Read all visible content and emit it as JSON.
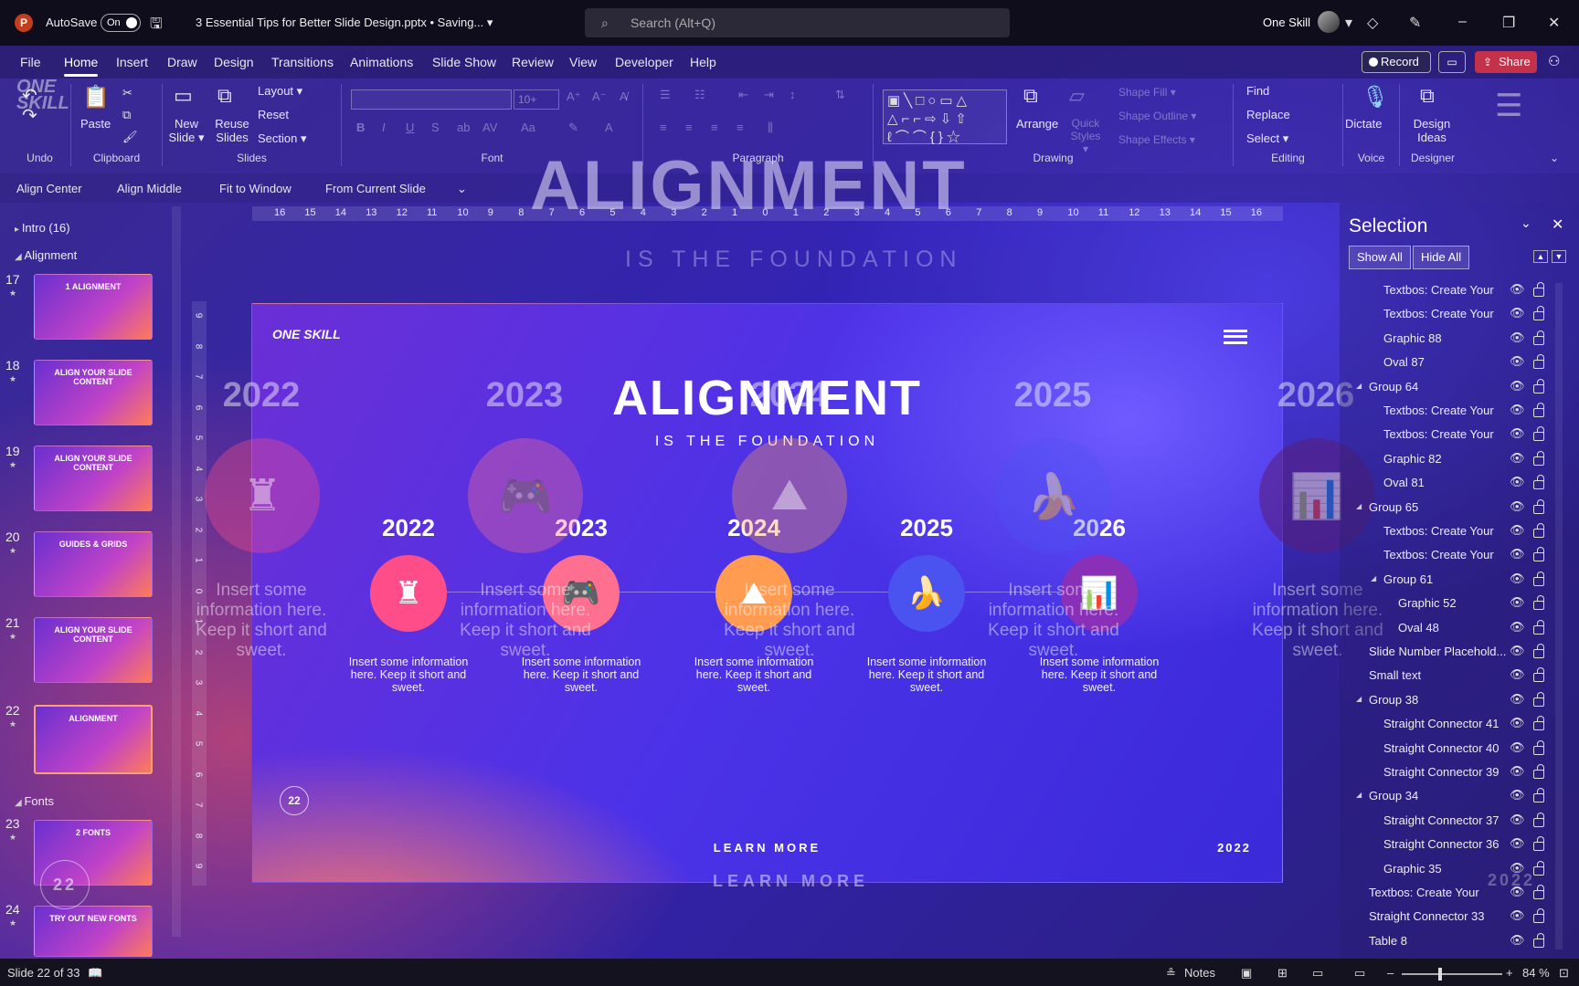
{
  "titlebar": {
    "autosave_label": "AutoSave",
    "autosave_state": "On",
    "doc_title": "3 Essential Tips for Better Slide Design.pptx • Saving... ▾",
    "search_placeholder": "Search (Alt+Q)",
    "user_name": "One Skill"
  },
  "menu": {
    "items": [
      "File",
      "Home",
      "Insert",
      "Draw",
      "Design",
      "Transitions",
      "Animations",
      "Slide Show",
      "Review",
      "View",
      "Developer",
      "Help"
    ],
    "active": "Home",
    "record": "Record",
    "share": "Share"
  },
  "ribbon": {
    "groups": {
      "undo": "Undo",
      "clipboard": "Clipboard",
      "slides": "Slides",
      "font": "Font",
      "paragraph": "Paragraph",
      "drawing": "Drawing",
      "editing": "Editing",
      "voice": "Voice",
      "designer": "Designer"
    },
    "paste": "Paste",
    "new_slide": "New Slide ▾",
    "reuse_slides": "Reuse Slides",
    "layout": "Layout ▾",
    "reset": "Reset",
    "section": "Section ▾",
    "font_size": "10+",
    "arrange": "Arrange",
    "quick_styles": "Quick Styles ▾",
    "shape_fill": "Shape Fill ▾",
    "shape_outline": "Shape Outline ▾",
    "shape_effects": "Shape Effects ▾",
    "find": "Find",
    "replace": "Replace",
    "select": "Select ▾",
    "dictate": "Dictate",
    "design_ideas": "Design Ideas"
  },
  "qat": {
    "align_center": "Align Center",
    "align_middle": "Align Middle",
    "fit_window": "Fit to Window",
    "from_current": "From Current Slide"
  },
  "overlay": {
    "title": "ALIGNMENT",
    "subtitle": "IS THE FOUNDATION",
    "years": [
      "2022",
      "2023",
      "2024",
      "2025",
      "2026"
    ],
    "desc": "Insert some information here. Keep it short and sweet.",
    "learn_more": "LEARN MORE",
    "footer_year": "2022"
  },
  "thumbnails": {
    "sections": {
      "intro": "Intro (16)",
      "alignment": "Alignment",
      "fonts": "Fonts"
    },
    "slides": [
      {
        "num": "17",
        "label": "1 ALIGNMENT"
      },
      {
        "num": "18",
        "label": "ALIGN YOUR SLIDE CONTENT"
      },
      {
        "num": "19",
        "label": "ALIGN YOUR SLIDE CONTENT"
      },
      {
        "num": "20",
        "label": "GUIDES & GRIDS"
      },
      {
        "num": "21",
        "label": "ALIGN YOUR SLIDE CONTENT"
      },
      {
        "num": "22",
        "label": "ALIGNMENT"
      },
      {
        "num": "23",
        "label": "2 FONTS"
      },
      {
        "num": "24",
        "label": "TRY OUT NEW FONTS"
      }
    ],
    "ghost_page": "22"
  },
  "ruler": {
    "h": [
      "16",
      "15",
      "14",
      "13",
      "12",
      "11",
      "10",
      "9",
      "8",
      "7",
      "6",
      "5",
      "4",
      "3",
      "2",
      "1",
      "0",
      "1",
      "2",
      "3",
      "4",
      "5",
      "6",
      "7",
      "8",
      "9",
      "10",
      "11",
      "12",
      "13",
      "14",
      "15",
      "16"
    ],
    "v": [
      "9",
      "8",
      "7",
      "6",
      "5",
      "4",
      "3",
      "2",
      "1",
      "0",
      "1",
      "2",
      "3",
      "4",
      "5",
      "6",
      "7",
      "8",
      "9"
    ]
  },
  "slide": {
    "logo": "ONE SKILL",
    "title": "ALIGNMENT",
    "subtitle": "IS THE FOUNDATION",
    "timeline": [
      {
        "year": "2022",
        "icon": "♜",
        "desc": "Insert some information here. Keep it short and sweet.",
        "color": "#ff4d8a"
      },
      {
        "year": "2023",
        "icon": "🎮",
        "desc": "Insert some information here. Keep it short and sweet.",
        "color": "#ff6f8f"
      },
      {
        "year": "2024",
        "icon": "⛰",
        "desc": "Insert some information here. Keep it short and sweet.",
        "color": "#ff9c52"
      },
      {
        "year": "2025",
        "icon": "🍌",
        "desc": "Insert some information here. Keep it short and sweet.",
        "color": "#4a52f0"
      },
      {
        "year": "2026",
        "icon": "📊",
        "desc": "Insert some information here. Keep it short and sweet.",
        "color": "#8a2fb8"
      }
    ],
    "page_num": "22",
    "learn_more": "LEARN MORE",
    "footer_year": "2022"
  },
  "selection_pane": {
    "title": "Selection",
    "show_all": "Show All",
    "hide_all": "Hide All",
    "items": [
      {
        "label": "Textbos: Create Your",
        "indent": 2,
        "group": false
      },
      {
        "label": "Textbos: Create Your",
        "indent": 2,
        "group": false
      },
      {
        "label": "Graphic 88",
        "indent": 2,
        "group": false
      },
      {
        "label": "Oval 87",
        "indent": 2,
        "group": false
      },
      {
        "label": "Group 64",
        "indent": 1,
        "group": true
      },
      {
        "label": "Textbos: Create Your",
        "indent": 2,
        "group": false
      },
      {
        "label": "Textbos: Create Your",
        "indent": 2,
        "group": false
      },
      {
        "label": "Graphic 82",
        "indent": 2,
        "group": false
      },
      {
        "label": "Oval 81",
        "indent": 2,
        "group": false
      },
      {
        "label": "Group 65",
        "indent": 1,
        "group": true
      },
      {
        "label": "Textbos: Create Your",
        "indent": 2,
        "group": false
      },
      {
        "label": "Textbos: Create Your",
        "indent": 2,
        "group": false
      },
      {
        "label": "Group 61",
        "indent": 2,
        "group": true
      },
      {
        "label": "Graphic 52",
        "indent": 3,
        "group": false
      },
      {
        "label": "Oval 48",
        "indent": 3,
        "group": false
      },
      {
        "label": "Slide Number Placehold...",
        "indent": 1,
        "group": false
      },
      {
        "label": "Small text",
        "indent": 1,
        "group": false
      },
      {
        "label": "Group 38",
        "indent": 1,
        "group": true
      },
      {
        "label": "Straight Connector 41",
        "indent": 2,
        "group": false
      },
      {
        "label": "Straight Connector 40",
        "indent": 2,
        "group": false
      },
      {
        "label": "Straight Connector 39",
        "indent": 2,
        "group": false
      },
      {
        "label": "Group 34",
        "indent": 1,
        "group": true
      },
      {
        "label": "Straight Connector 37",
        "indent": 2,
        "group": false
      },
      {
        "label": "Straight Connector 36",
        "indent": 2,
        "group": false
      },
      {
        "label": "Graphic 35",
        "indent": 2,
        "group": false
      },
      {
        "label": "Textbos: Create Your",
        "indent": 1,
        "group": false
      },
      {
        "label": "Straight Connector 33",
        "indent": 1,
        "group": false
      },
      {
        "label": "Table 8",
        "indent": 1,
        "group": false
      }
    ]
  },
  "status": {
    "slide_info": "Slide 22 of 33",
    "notes": "Notes",
    "zoom": "84 %"
  }
}
